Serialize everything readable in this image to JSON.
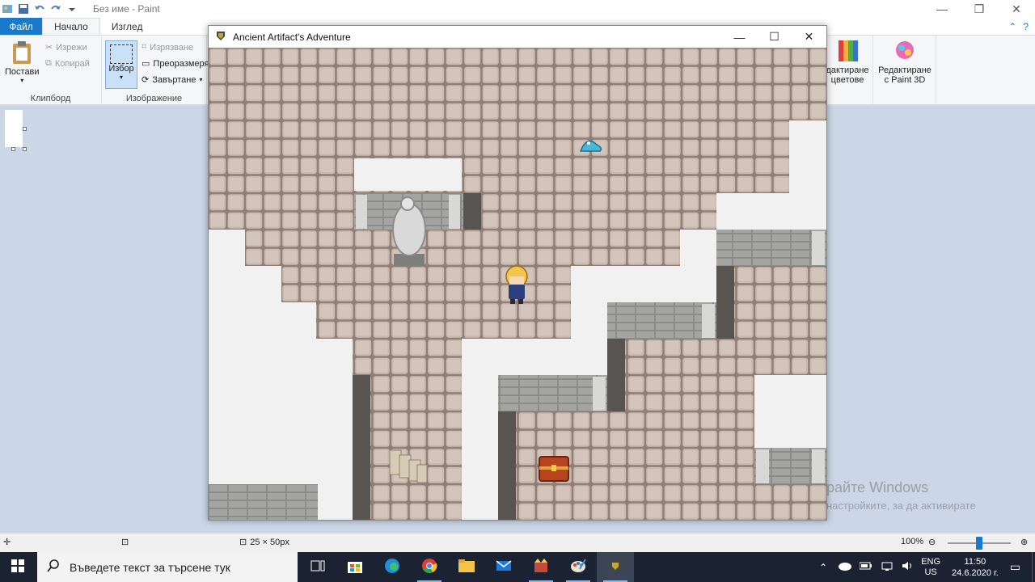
{
  "paint": {
    "window_title": "Без име - Paint",
    "tabs": {
      "file": "Файл",
      "home": "Начало",
      "view": "Изглед"
    },
    "clipboard": {
      "paste": "Постави",
      "cut": "Изрежи",
      "copy": "Копирай",
      "group": "Клипборд"
    },
    "image": {
      "select": "Избор",
      "crop": "Изрязване",
      "resize": "Преоразмеря",
      "rotate": "Завъртане",
      "group": "Изображение"
    },
    "edit_colors": "дактиране\nцветове",
    "edit_colors_l1": "дактиране",
    "edit_colors_l2": "цветове",
    "paint3d_l1": "Редактиране",
    "paint3d_l2": "с Paint 3D"
  },
  "statusbar": {
    "size": "25 × 50px",
    "zoom": "100%",
    "zoom_level": 0.5
  },
  "watermark": {
    "line1": "райте Windows",
    "line2": "настройките, за да активирате"
  },
  "game": {
    "title": "Ancient Artifact's Adventure"
  },
  "taskbar": {
    "search_placeholder": "Въведете текст за търсене тук",
    "lang_l1": "ENG",
    "lang_l2": "US",
    "time": "11:50",
    "date": "24.6.2020 г."
  },
  "colors": {
    "accent": "#1979ca",
    "floor_tile": "#c9b9ae",
    "tile_border": "#8f7f78",
    "wall": "#f1f1f1",
    "stone_wall": "#9a9a98",
    "dark_wall": "#575452",
    "taskbar": "#1b2332"
  }
}
